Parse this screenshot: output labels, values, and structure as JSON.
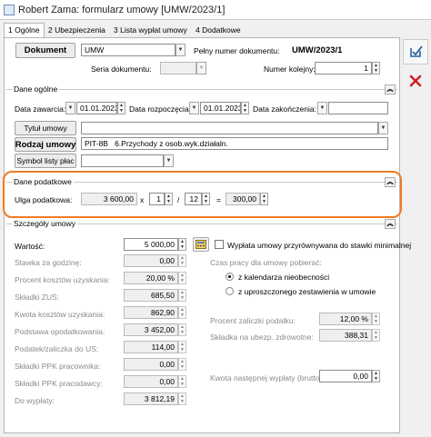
{
  "window": {
    "title": "Robert Zama: formularz umowy [UMW/2023/1]"
  },
  "tabs": [
    {
      "label": "1 Ogólne"
    },
    {
      "label": "2 Ubezpieczenia"
    },
    {
      "label": "3 Lista wypłat umowy"
    },
    {
      "label": "4 Dodatkowe"
    }
  ],
  "header": {
    "dokument_button": "Dokument",
    "dokument_value": "UMW",
    "pelny_numer_label": "Pełny numer dokumentu:",
    "pelny_numer_value": "UMW/2023/1",
    "seria_label": "Seria dokumentu:",
    "numer_kolejny_label": "Numer kolejny:",
    "numer_kolejny_value": "1"
  },
  "dane_ogolne": {
    "title": "Dane ogólne",
    "data_zawarcia_label": "Data zawarcia:",
    "data_zawarcia_value": "01.01.2023",
    "data_rozpoczecia_label": "Data rozpoczęcia:",
    "data_rozpoczecia_value": "01.01.2023",
    "data_zakonczenia_label": "Data zakończenia:",
    "data_zakonczenia_value": "",
    "tytul_button": "Tytuł umowy",
    "tytul_value": "",
    "rodzaj_button": "Rodzaj umowy",
    "rodzaj_code": "PIT-8B",
    "rodzaj_desc": "6.Przychody z osob.wyk.działaln.",
    "symbol_button": "Symbol listy płac",
    "symbol_value": ""
  },
  "dane_podatkowe": {
    "title": "Dane podatkowe",
    "ulga_label": "Ulga podatkowa:",
    "ulga_value": "3 600,00",
    "x_sign": "x",
    "mult_num": "1",
    "slash": "/",
    "mult_den": "12",
    "eq_sign": "=",
    "result": "300,00"
  },
  "szczegoly": {
    "title": "Szczegóły umowy",
    "wartosc_label": "Wartość:",
    "wartosc_value": "5 000,00",
    "wyplata_checkbox_label": "Wypłata umowy przyrównywana do stawki minimalnej",
    "rows": [
      {
        "label": "Stawka za godzinę:",
        "value": "0,00"
      },
      {
        "label": "Procent kosztów uzyskania:",
        "value": "20,00 %"
      },
      {
        "label": "Składki ZUS:",
        "value": "685,50"
      },
      {
        "label": "Kwota kosztów uzyskania:",
        "value": "862,90"
      },
      {
        "label": "Podstawa opodatkowania:",
        "value": "3 452,00"
      },
      {
        "label": "Podatek/zaliczka do US:",
        "value": "114,00"
      },
      {
        "label": "Składki PPK pracownika:",
        "value": "0,00"
      },
      {
        "label": "Składki PPK pracodawcy:",
        "value": "0,00"
      },
      {
        "label": "Do wypłaty:",
        "value": "3 812,19"
      }
    ],
    "czas_pracy_label": "Czas pracy dla umowy pobierać:",
    "radio1_label": "z kalendarza nieobecności",
    "radio2_label": "z uproszczonego zestawienia w umowie",
    "procent_zaliczki_label": "Procent zaliczki podatku:",
    "procent_zaliczki_value": "12,00 %",
    "skladka_zdrowotne_label": "Składka na ubezp. zdrowotne:",
    "skladka_zdrowotne_value": "388,31",
    "kwota_nastepnej_label": "Kwota następnej wypłaty (brutto):",
    "kwota_nastepnej_value": "0,00"
  },
  "colors": {
    "highlight": "#f07b23",
    "accent_blue": "#2a5fa8",
    "cancel_red": "#d0202a"
  },
  "icons": {
    "save": "save-icon",
    "cancel": "close-icon",
    "calculator": "calculator-icon"
  }
}
